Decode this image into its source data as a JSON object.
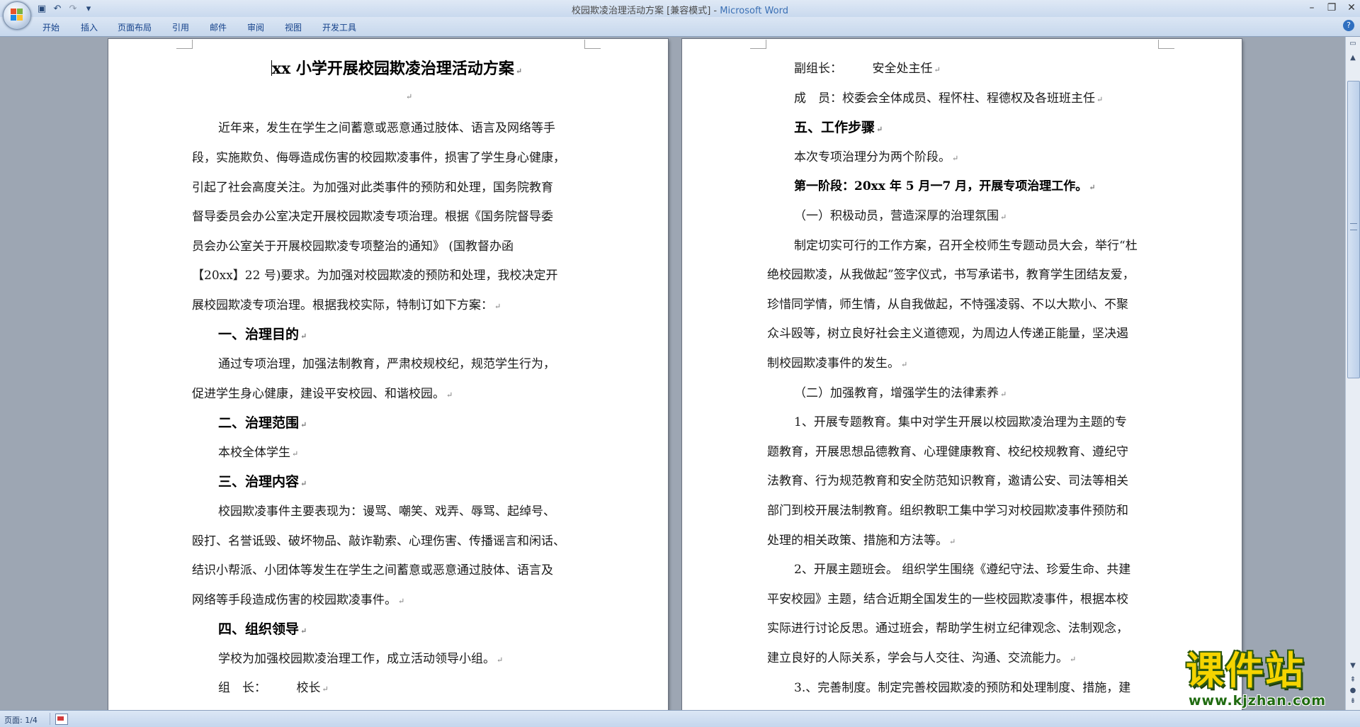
{
  "window": {
    "title_doc": "校园欺凌治理活动方案 [兼容模式] - ",
    "title_app": "Microsoft Word"
  },
  "qat": {
    "icons": [
      "save-icon",
      "undo-icon",
      "redo-icon",
      "customize-icon"
    ],
    "undo_glyph": "↶",
    "redo_glyph": "↷",
    "save_glyph": "▣",
    "more_glyph": "▾"
  },
  "win_controls": {
    "minimize": "–",
    "restore": "❐",
    "close": "✕"
  },
  "ribbon": {
    "tabs": [
      "开始",
      "插入",
      "页面布局",
      "引用",
      "邮件",
      "审阅",
      "视图",
      "开发工具"
    ],
    "help": "?"
  },
  "left_page": {
    "title": "xx 小学开展校园欺凌治理活动方案",
    "lines": [
      "近年来，发生在学生之间蓄意或恶意通过肢体、语言及网络等手",
      "段，实施欺负、侮辱造成伤害的校园欺凌事件，损害了学生身心健康，",
      "引起了社会高度关注。为加强对此类事件的预防和处理，国务院教育",
      "督导委员会办公室决定开展校园欺凌专项治理。根据《国务院督导委",
      "员会办公室关于开展校园欺凌专项整治的通知》 (国教督办函",
      "【20xx】22 号)要求。为加强对校园欺凌的预防和处理，我校决定开",
      "展校园欺凌专项治理。根据我校实际，特制订如下方案：",
      "一、治理目的",
      "通过专项治理，加强法制教育，严肃校规校纪，规范学生行为，",
      "促进学生身心健康，建设平安校园、和谐校园。",
      "二、治理范围",
      "本校全体学生",
      "三、治理内容",
      "校园欺凌事件主要表现为：谩骂、嘲笑、戏弄、辱骂、起绰号、",
      "殴打、名誉诋毁、破坏物品、敲诈勒索、心理伤害、传播谣言和闲话、",
      "结识小帮派、小团体等发生在学生之间蓄意或恶意通过肢体、语言及",
      "网络等手段造成伤害的校园欺凌事件。",
      "四、组织领导",
      "学校为加强校园欺凌治理工作，成立活动领导小组。",
      "组　长：　　　校长"
    ]
  },
  "right_page": {
    "lines": [
      "副组长：　　　安全处主任",
      "成　员：校委会全体成员、程怀柱、程德权及各班班主任",
      "五、工作步骤",
      "本次专项治理分为两个阶段。",
      "第一阶段：20xx 年 5 月一7 月，开展专项治理工作。",
      "（一）积极动员，营造深厚的治理氛围",
      "制定切实可行的工作方案，召开全校师生专题动员大会，举行“杜",
      "绝校园欺凌，从我做起”签字仪式，书写承诺书，教育学生团结友爱，",
      "珍惜同学情，师生情，从自我做起，不恃强凌弱、不以大欺小、不聚",
      "众斗殴等，树立良好社会主义道德观，为周边人传递正能量，坚决遏",
      "制校园欺凌事件的发生。",
      "（二）加强教育，增强学生的法律素养",
      "1、开展专题教育。集中对学生开展以校园欺凌治理为主题的专",
      "题教育，开展思想品德教育、心理健康教育、校纪校规教育、遵纪守",
      "法教育、行为规范教育和安全防范知识教育，邀请公安、司法等相关",
      "部门到校开展法制教育。组织教职工集中学习对校园欺凌事件预防和",
      "处理的相关政策、措施和方法等。",
      "2、开展主题班会。 组织学生围绕《遵纪守法、珍爱生命、共建",
      "平安校园》主题，结合近期全国发生的一些校园欺凌事件，根据本校",
      "实际进行讨论反思。通过班会，帮助学生树立纪律观念、法制观念，",
      "建立良好的人际关系，学会与人交往、沟通、交流能力。",
      "3.、完善制度。制定完善校园欺凌的预防和处理制度、措施，建"
    ]
  },
  "paragraph_mark": "↵",
  "status": {
    "page": "页面: 1/4"
  },
  "watermark": {
    "main": "课件站",
    "url": "www.kjzhan.com"
  }
}
